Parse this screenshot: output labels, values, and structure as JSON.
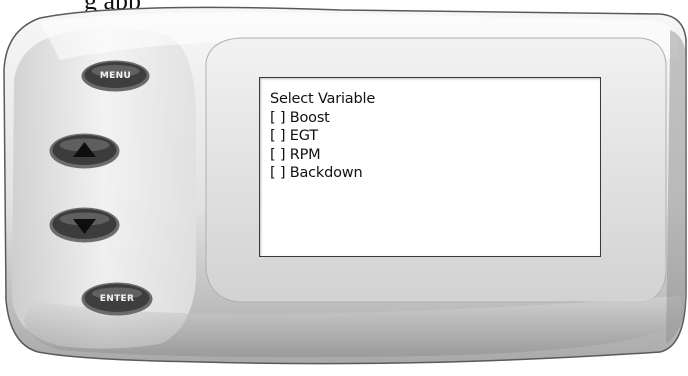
{
  "caption": "g app",
  "buttons": {
    "menu_label": "MENU",
    "enter_label": "ENTER"
  },
  "screen": {
    "title": "Select Variable",
    "options": [
      "[ ] Boost",
      "[ ] EGT",
      "[ ] RPM",
      "[ ] Backdown"
    ]
  },
  "colors": {
    "bezel_light": "#f4f4f4",
    "bezel_mid": "#d8d8d8",
    "bezel_dark": "#9a9a9a",
    "button_dark": "#3c3c3c",
    "screen_bg": "#ffffff"
  },
  "icons": {
    "up": "arrow-up-icon",
    "down": "arrow-down-icon"
  }
}
